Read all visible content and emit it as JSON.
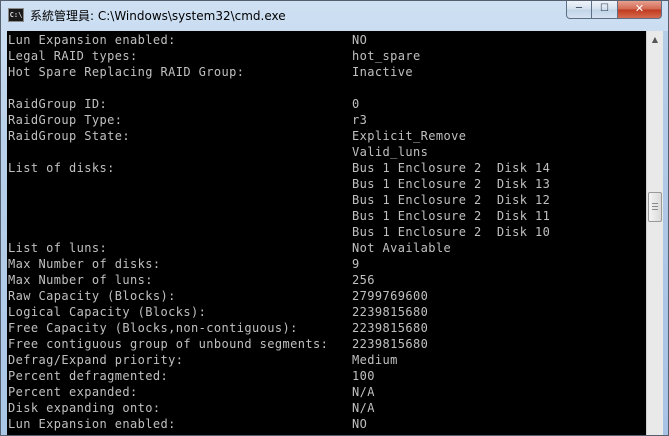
{
  "window": {
    "icon_text": "C:\\",
    "title": "系統管理員: C:\\Windows\\system32\\cmd.exe",
    "minimize_glyph": "─",
    "maximize_glyph": "☐",
    "close_glyph": "✕"
  },
  "console": {
    "lines": [
      {
        "label": "Lun Expansion enabled:",
        "value": "NO"
      },
      {
        "label": "Legal RAID types:",
        "value": "hot_spare"
      },
      {
        "label": "Hot Spare Replacing RAID Group:",
        "value": "Inactive"
      },
      {
        "label": "",
        "value": ""
      },
      {
        "label": "RaidGroup ID:",
        "value": "0"
      },
      {
        "label": "RaidGroup Type:",
        "value": "r3"
      },
      {
        "label": "RaidGroup State:",
        "value": "Explicit_Remove"
      },
      {
        "label": "",
        "value": "Valid_luns"
      },
      {
        "label": "List of disks:",
        "value": "Bus 1 Enclosure 2  Disk 14"
      },
      {
        "label": "",
        "value": "Bus 1 Enclosure 2  Disk 13"
      },
      {
        "label": "",
        "value": "Bus 1 Enclosure 2  Disk 12"
      },
      {
        "label": "",
        "value": "Bus 1 Enclosure 2  Disk 11"
      },
      {
        "label": "",
        "value": "Bus 1 Enclosure 2  Disk 10"
      },
      {
        "label": "List of luns:",
        "value": "Not Available"
      },
      {
        "label": "Max Number of disks:",
        "value": "9"
      },
      {
        "label": "Max Number of luns:",
        "value": "256"
      },
      {
        "label": "Raw Capacity (Blocks):",
        "value": "2799769600"
      },
      {
        "label": "Logical Capacity (Blocks):",
        "value": "2239815680"
      },
      {
        "label": "Free Capacity (Blocks,non-contiguous):",
        "value": "2239815680"
      },
      {
        "label": "Free contiguous group of unbound segments:",
        "value": "2239815680"
      },
      {
        "label": "Defrag/Expand priority:",
        "value": "Medium"
      },
      {
        "label": "Percent defragmented:",
        "value": "100"
      },
      {
        "label": "Percent expanded:",
        "value": "N/A"
      },
      {
        "label": "Disk expanding onto:",
        "value": "N/A"
      },
      {
        "label": "Lun Expansion enabled:",
        "value": "NO"
      }
    ]
  },
  "scrollbar": {
    "up_arrow": "▲",
    "position_fraction": 0.4
  },
  "colors": {
    "console_bg": "#000000",
    "console_fg": "#c0c0c0",
    "titlebar": "#b9d1ea",
    "close_button": "#c0391e"
  }
}
